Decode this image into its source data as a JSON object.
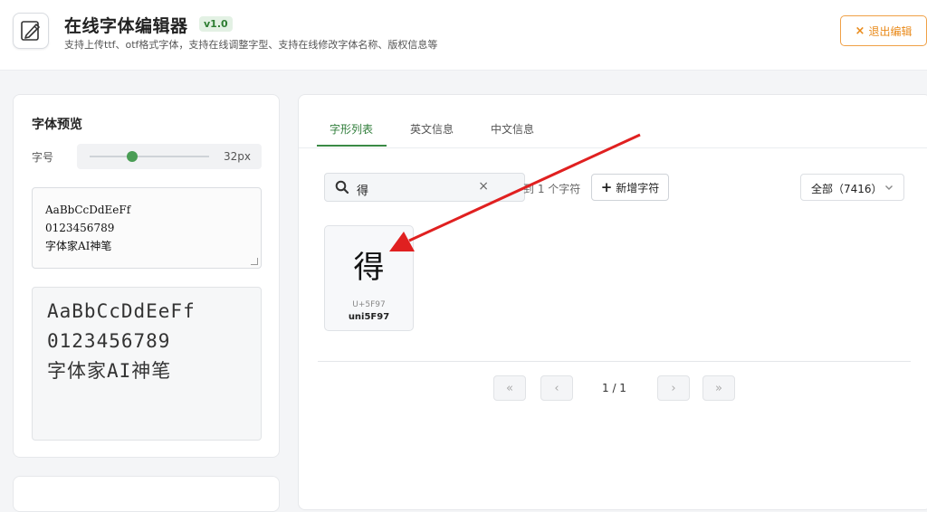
{
  "header": {
    "title": "在线字体编辑器",
    "version": "v1.0",
    "subtitle": "支持上传ttf、otf格式字体，支持在线调整字型、支持在线修改字体名称、版权信息等",
    "exit_label": "退出编辑",
    "exit_icon": "×"
  },
  "preview": {
    "title": "字体预览",
    "size_label": "字号",
    "size_value": "32px",
    "input_lines": [
      "AaBbCcDdEeFf",
      "0123456789",
      "字体家AI神笔"
    ],
    "preview_lines": [
      "AaBbCcDdEeFf",
      "0123456789",
      "字体家AI神笔"
    ]
  },
  "tabs": [
    {
      "label": "字形列表"
    },
    {
      "label": "英文信息"
    },
    {
      "label": "中文信息"
    }
  ],
  "toolbar": {
    "search_value": "得",
    "clear_icon": "×",
    "match_text": "到 1 个字符",
    "add_label": "新增字符",
    "add_icon": "+",
    "filter_label": "全部（7416）"
  },
  "glyphs": [
    {
      "char": "得",
      "code": "U+5F97",
      "name": "uni5F97"
    }
  ],
  "pagination": {
    "first": "«",
    "prev": "‹",
    "page_text": "1 / 1",
    "next": "›",
    "last": "»"
  },
  "colors": {
    "accent_green": "#3a8a45",
    "exit_orange": "#e98a1a",
    "arrow_red": "#e02020"
  }
}
